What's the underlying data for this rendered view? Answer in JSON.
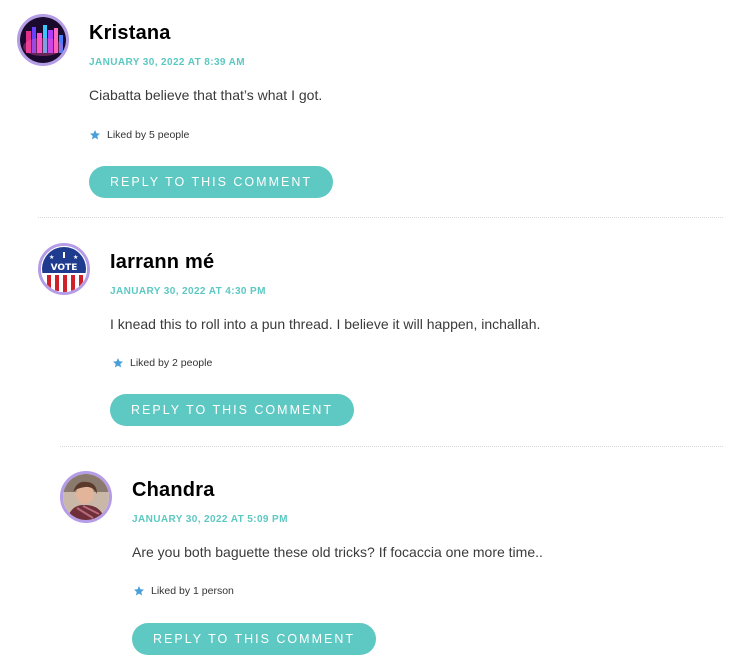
{
  "colors": {
    "accent": "#5ec8c2",
    "date": "#5bc8c1",
    "avatar_ring": "#b59ce6",
    "star": "#4a9fd8"
  },
  "comments": [
    {
      "author": "Kristana",
      "date": "JANUARY 30, 2022 AT 8:39 AM",
      "text": "Ciabatta believe that that’s what I got.",
      "likes": "Liked by 5 people",
      "reply_label": "REPLY TO THIS COMMENT",
      "avatar_icon": "neon-lights-avatar"
    },
    {
      "author": "Iarrann mé",
      "date": "JANUARY 30, 2022 AT 4:30 PM",
      "text": "I knead this to roll into a pun thread. I believe it will happen, inchallah.",
      "likes": "Liked by 2 people",
      "reply_label": "REPLY TO THIS COMMENT",
      "avatar_icon": "vote-badge-avatar",
      "avatar_badge_text": "VOTE"
    },
    {
      "author": "Chandra",
      "date": "JANUARY 30, 2022 AT 5:09 PM",
      "text": "Are you both baguette these old tricks? If focaccia one more time..",
      "likes": "Liked by 1 person",
      "reply_label": "REPLY TO THIS COMMENT",
      "avatar_icon": "user-photo-avatar"
    }
  ]
}
